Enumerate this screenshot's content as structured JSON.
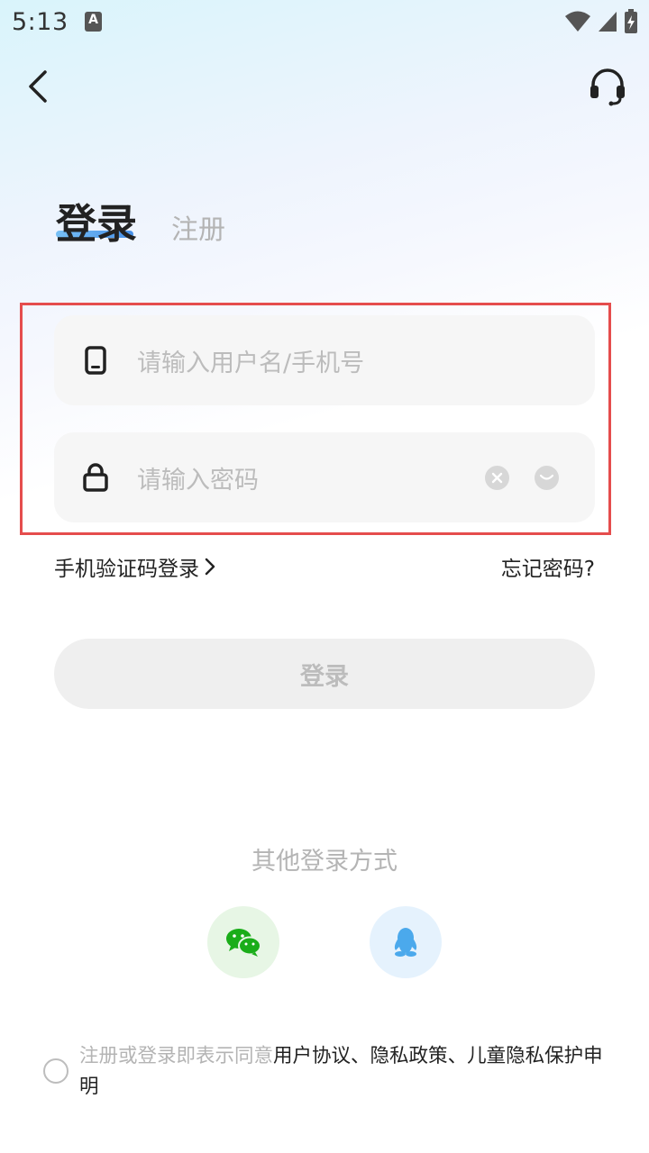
{
  "status_bar": {
    "time": "5:13",
    "notification_badge": "A"
  },
  "header": {
    "back_icon": "back-arrow-icon",
    "support_icon": "headset-icon"
  },
  "tabs": {
    "login": "登录",
    "register": "注册",
    "active": "login",
    "accent": "#2a7fe5"
  },
  "form": {
    "username_placeholder": "请输入用户名/手机号",
    "password_placeholder": "请输入密码",
    "username_icon": "phone-icon",
    "password_icon": "lock-icon",
    "highlight_color": "#e54d4d"
  },
  "links": {
    "sms_login": "手机验证码登录",
    "forgot_password": "忘记密码?"
  },
  "login_button": {
    "label": "登录"
  },
  "other_login": {
    "title": "其他登录方式",
    "wechat_color": "#1aad19",
    "qq_color": "#4ba9ec"
  },
  "agreement": {
    "prefix": "注册或登录即表示同意",
    "user_agreement": "用户协议",
    "sep1": "、",
    "privacy_policy": "隐私政策",
    "sep2": "、",
    "child_privacy": "儿童隐私保护申明"
  }
}
